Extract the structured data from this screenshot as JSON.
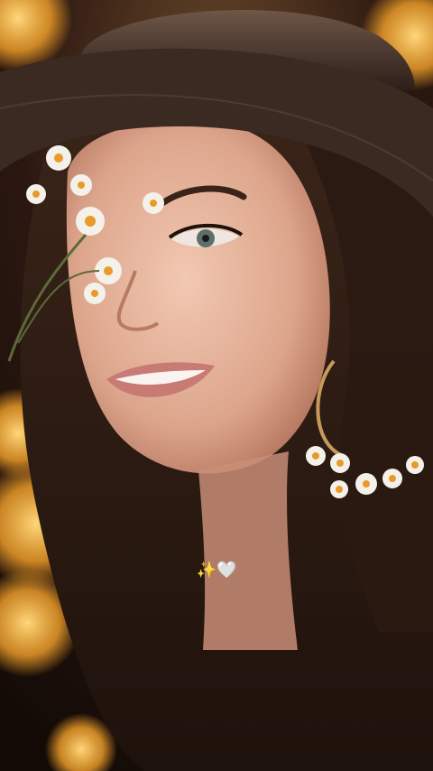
{
  "overlay": {
    "caption": "✨🤍"
  },
  "palette": {
    "background_dark": "#1a0f0a",
    "hair": "#2a1a12",
    "hat": "#3b2a22",
    "hat_brim": "#2e211b",
    "skin": "#e8b8a0",
    "skin_shadow": "#c98e77",
    "lips": "#c77b74",
    "flower_petal": "#f4f1ea",
    "flower_center": "#e89a2a",
    "bokeh_gold": "#f6b23a",
    "bokeh_blue": "#8a8ee8",
    "earring_gold": "#c79a5c"
  }
}
